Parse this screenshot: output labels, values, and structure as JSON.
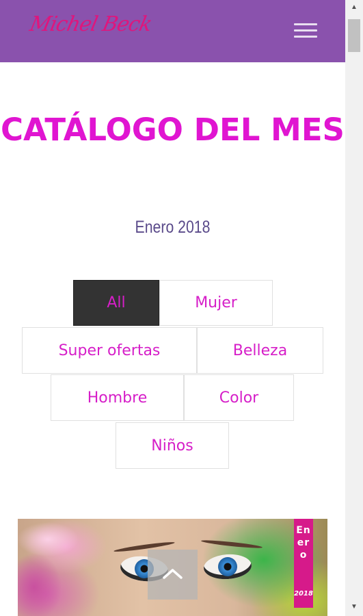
{
  "header": {
    "logo_text": "Michel Beck",
    "menu_icon": "hamburger-icon"
  },
  "main": {
    "title": "CATÁLOGO DEL MES",
    "subtitle": "Enero 2018",
    "filters": [
      {
        "label": "All",
        "active": true
      },
      {
        "label": "Mujer",
        "active": false
      },
      {
        "label": "Super ofertas",
        "active": false
      },
      {
        "label": "Belleza",
        "active": false
      },
      {
        "label": "Hombre",
        "active": false
      },
      {
        "label": "Color",
        "active": false
      },
      {
        "label": "Niños",
        "active": false
      }
    ]
  },
  "banner": {
    "tag_month": "Enero",
    "tag_year": "2018"
  },
  "back_to_top": {
    "icon": "chevron-up-icon"
  },
  "colors": {
    "header_bg": "#8a52ad",
    "accent": "#e015d1",
    "filter_text": "#d61ec8",
    "active_filter_bg": "#333333",
    "subtitle": "#5a4a8a"
  }
}
